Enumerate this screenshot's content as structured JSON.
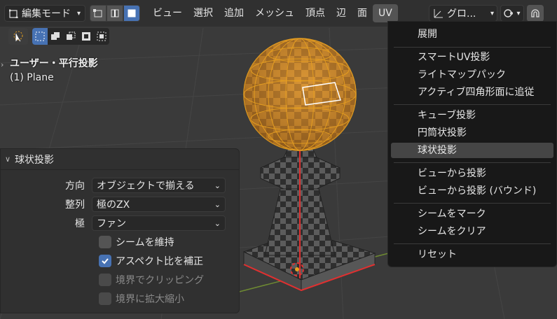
{
  "header": {
    "mode": "編集モード",
    "menu": [
      "ビュー",
      "選択",
      "追加",
      "メッシュ",
      "頂点",
      "辺",
      "面",
      "UV"
    ],
    "active_menu_index": 7,
    "transform_orientation": "グロ..."
  },
  "viewport": {
    "view_name": "ユーザー・平行投影",
    "object_name": "(1) Plane"
  },
  "operator_panel": {
    "title": "球状投影",
    "direction_label": "方向",
    "direction_value": "オブジェクトで揃える",
    "align_label": "整列",
    "align_value": "極のZX",
    "pole_label": "極",
    "pole_value": "ファン",
    "checkboxes": [
      {
        "label": "シームを維持",
        "checked": false,
        "enabled": true
      },
      {
        "label": "アスペクト比を補正",
        "checked": true,
        "enabled": true
      },
      {
        "label": "境界でクリッピング",
        "checked": false,
        "enabled": false
      },
      {
        "label": "境界に拡大縮小",
        "checked": false,
        "enabled": false
      }
    ]
  },
  "uv_menu": {
    "items": [
      "展開",
      "スマートUV投影",
      "ライトマップパック",
      "アクティブ四角形面に追従",
      "キューブ投影",
      "円筒状投影",
      "球状投影",
      "ビューから投影",
      "ビューから投影 (バウンド)",
      "シームをマーク",
      "シームをクリア",
      "リセット"
    ],
    "highlighted": "球状投影"
  },
  "colors": {
    "accent": "#4772b3",
    "selection_orange": "#e8a020",
    "seam_red": "#e03030"
  }
}
